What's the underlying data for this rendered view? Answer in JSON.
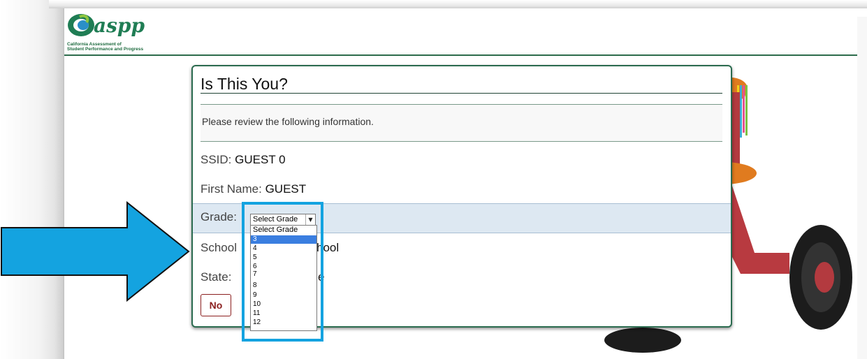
{
  "logo": {
    "wordmark": "caaspp",
    "subtitle_line1": "California Assessment of",
    "subtitle_line2": "Student Performance and Progress"
  },
  "dialog": {
    "title": "Is This You?",
    "notice": "Please review the following information.",
    "ssid_label": "SSID:",
    "ssid_value": "GUEST 0",
    "first_name_label": "First Name:",
    "first_name_value": "GUEST",
    "grade_label": "Grade:",
    "school_label_visible": "School",
    "school_value_visible": "hool",
    "state_label_visible": "State:",
    "state_value_visible": "e",
    "no_button": "No"
  },
  "grade_select": {
    "selected_value": "Select Grade",
    "options": [
      "Select Grade",
      "3",
      "4",
      "5",
      "6",
      "7",
      "8",
      "9",
      "10",
      "11",
      "12"
    ],
    "highlighted_option": "3"
  },
  "colors": {
    "brand_green": "#2b6b4f",
    "no_button_red": "#8b1f1f",
    "callout_blue": "#14a3e0",
    "grade_row_bg": "#dde8f2",
    "option_highlight": "#3a7ee0"
  },
  "icons": {
    "dropdown_chevron": "chevron-down-icon",
    "scroll_down": "scroll-down-icon",
    "callout_arrow": "arrow-right-icon"
  }
}
